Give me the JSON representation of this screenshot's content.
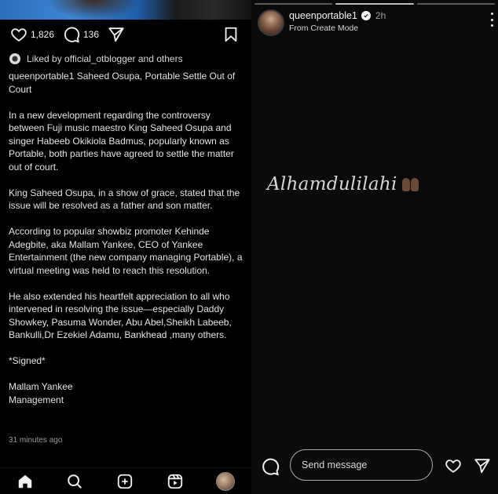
{
  "post": {
    "likes": "1,826",
    "comments": "136",
    "liked_by_text": "Liked by official_otblogger and others",
    "title": "queenportable1 Saheed Osupa, Portable Settle Out of Court",
    "paragraphs": [
      "In a new development regarding the controversy between Fuji music maestro King Saheed Osupa and singer Habeeb Okikiola Badmus, popularly known as Portable, both parties have agreed to settle the matter out of court.",
      "King Saheed Osupa, in a show of grace,  stated that the issue will be resolved as a father and son matter.",
      "According to popular showbiz promoter Kehinde Adegbite, aka Mallam Yankee, CEO of Yankee Entertainment (the new company managing Portable), a virtual meeting was held to reach this resolution.",
      "He also extended his heartfelt appreciation to all who intervened in resolving the issue—especially Daddy Showkey, Pasuma Wonder, Abu Abel,Sheikh Labeeb, Bankulli,Dr Ezekiel Adamu, Bankhead ,many others.",
      "*Signed*"
    ],
    "signature_line1": "Mallam Yankee",
    "signature_line2": "Management",
    "time_ago": "31 minutes ago"
  },
  "story": {
    "username": "queenportable1",
    "time": "2h",
    "subtitle": "From Create Mode",
    "text": "Alhamdulilahi",
    "message_placeholder": "Send message",
    "progress_segments": 3,
    "active_segment": 1
  },
  "icons": {
    "like": "heart-icon",
    "comment": "comment-icon",
    "share": "send-icon",
    "save": "bookmark-icon",
    "home": "home-icon",
    "search": "search-icon",
    "create": "plus-square-icon",
    "reels": "reels-icon"
  },
  "colors": {
    "background": "#000000",
    "text": "#e8e8e8",
    "muted": "#9a9a9a"
  }
}
